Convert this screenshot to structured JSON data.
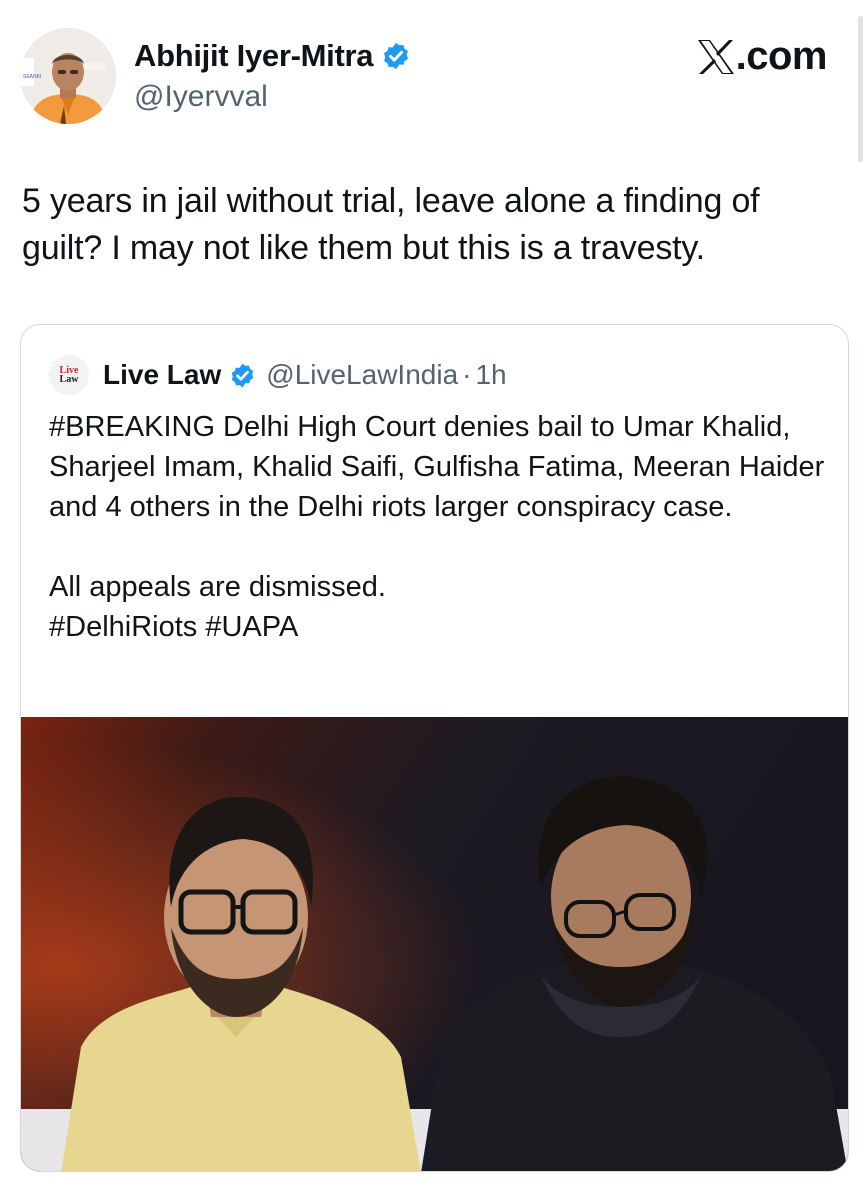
{
  "author": {
    "name": "Abhijit Iyer-Mitra",
    "handle": "@Iyervval",
    "verified": true,
    "avatar_banner_text": "SEANKI"
  },
  "brand": {
    "label": ".com",
    "logo": "x-logo"
  },
  "tweet": {
    "text": "5 years in jail without trial, leave alone a finding of guilt? I may not like them but this is a travesty."
  },
  "quoted": {
    "name": "Live Law",
    "handle": "@LiveLawIndia",
    "separator": "·",
    "time": "1h",
    "logo_text_top": "Live",
    "logo_text_bottom": "Law",
    "body_line1": "#BREAKING Delhi High Court denies bail to Umar Khalid, Sharjeel Imam, Khalid Saifi, Gulfisha Fatima, Meeran Haider and 4 others in the Delhi riots larger conspiracy case.",
    "body_line2": "All appeals are dismissed.",
    "body_line3": "#DelhiRiots #UAPA"
  },
  "colors": {
    "verified_blue": "#1d9bf0",
    "text": "#0f1419",
    "secondary": "#536471",
    "border": "#cfd9de"
  }
}
